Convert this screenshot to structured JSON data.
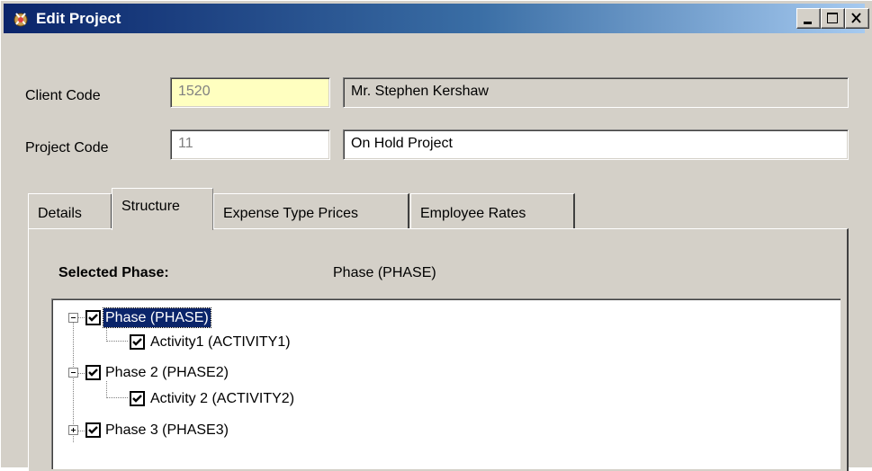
{
  "window": {
    "title": "Edit Project",
    "buttons": [
      "minimize",
      "maximize",
      "close"
    ]
  },
  "client": {
    "label": "Client Code",
    "code": "1520",
    "name": "Mr. Stephen Kershaw"
  },
  "project": {
    "label": "Project Code",
    "code": "11",
    "name": "On Hold Project"
  },
  "tabs": [
    {
      "label": "Details"
    },
    {
      "label": "Structure",
      "active": true
    },
    {
      "label": "Expense Type Prices"
    },
    {
      "label": "Employee Rates"
    }
  ],
  "structure": {
    "selected_label": "Selected Phase:",
    "selected_value": "Phase (PHASE)",
    "tree": [
      {
        "label": "Phase (PHASE)",
        "checked": true,
        "expanded": true,
        "selected": true
      },
      {
        "label": "Activity1 (ACTIVITY1)",
        "checked": true
      },
      {
        "label": "Phase 2 (PHASE2)",
        "checked": true,
        "expanded": true
      },
      {
        "label": "Activity 2 (ACTIVITY2)",
        "checked": true
      },
      {
        "label": "Phase 3 (PHASE3)",
        "checked": true,
        "expanded": false
      }
    ]
  },
  "colors": {
    "title_start": "#0a246a",
    "title_end": "#a6caf0",
    "client_code_bg": "#ffffc0",
    "face": "#d4d0c8",
    "selection": "#0a246a"
  }
}
